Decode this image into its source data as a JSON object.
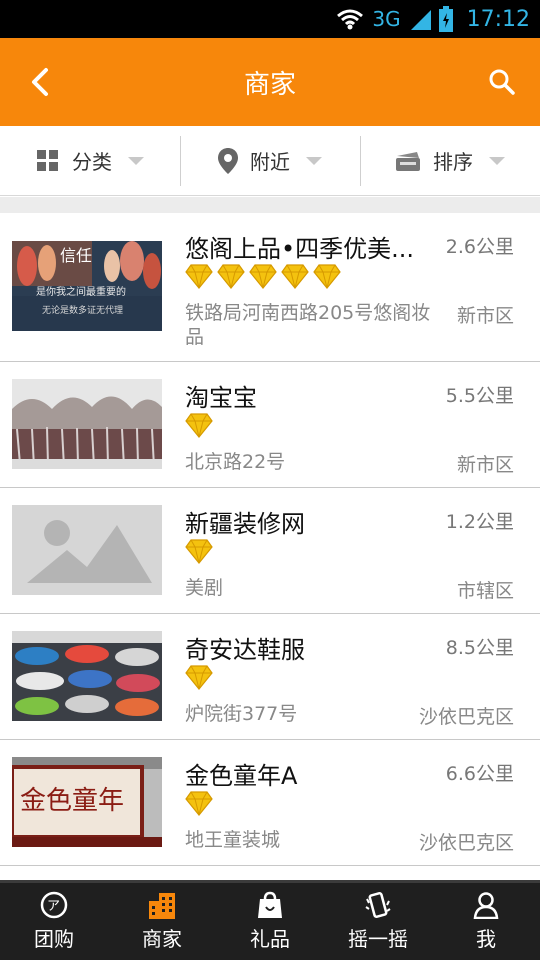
{
  "status_bar": {
    "network": "3G",
    "time": "17:12"
  },
  "header": {
    "title": "商家",
    "back_icon": "back-arrow-icon",
    "search_icon": "search-icon",
    "color": "#f7870b"
  },
  "filters": [
    {
      "label": "分类",
      "icon": "grid-icon"
    },
    {
      "label": "附近",
      "icon": "location-pin-icon"
    },
    {
      "label": "排序",
      "icon": "sort-icon"
    }
  ],
  "merchants": [
    {
      "name": "悠阁上品•四季优美...",
      "distance": "2.6公里",
      "diamonds": 5,
      "address": "铁路局河南西路205号悠阁妆品",
      "area": "新市区",
      "thumb": "cosmetics-photo",
      "thumb_text": "信任",
      "thumb_caption": "是你我之间最重要的",
      "thumb_caption2": "无论是数多证无代理"
    },
    {
      "name": "淘宝宝",
      "distance": "5.5公里",
      "diamonds": 1,
      "address": "北京路22号",
      "area": "新市区",
      "thumb": "snow-trees-photo"
    },
    {
      "name": "新疆装修网",
      "distance": "1.2公里",
      "diamonds": 1,
      "address": "美剧",
      "area": "市辖区",
      "thumb": "placeholder-image"
    },
    {
      "name": "奇安达鞋服",
      "distance": "8.5公里",
      "diamonds": 1,
      "address": "炉院街377号",
      "area": "沙依巴克区",
      "thumb": "shoes-photo"
    },
    {
      "name": "金色童年A",
      "distance": "6.6公里",
      "diamonds": 1,
      "address": "地王童装城",
      "area": "沙依巴克区",
      "thumb": "store-sign-photo",
      "thumb_text": "金色童年"
    }
  ],
  "tabs": [
    {
      "label": "团购",
      "icon": "group-buy-icon",
      "active": false
    },
    {
      "label": "商家",
      "icon": "merchant-building-icon",
      "active": true
    },
    {
      "label": "礼品",
      "icon": "gift-bag-icon",
      "active": false
    },
    {
      "label": "摇一摇",
      "icon": "shake-phone-icon",
      "active": false
    },
    {
      "label": "我",
      "icon": "profile-icon",
      "active": false
    }
  ]
}
